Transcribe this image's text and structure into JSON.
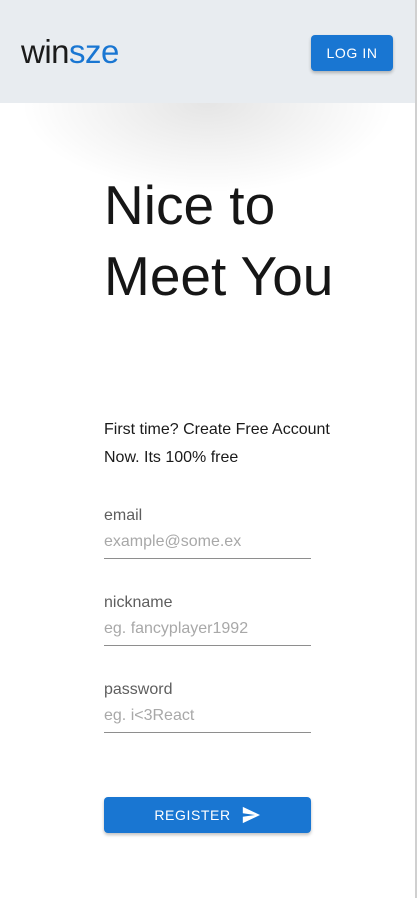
{
  "header": {
    "logo_part1": "win",
    "logo_part2": "sze",
    "login_label": "LOG IN"
  },
  "hero": {
    "title": "Nice to Meet You",
    "subtitle": "First time? Create Free Account Now. Its 100% free"
  },
  "form": {
    "email": {
      "label": "email",
      "placeholder": "example@some.ex",
      "value": ""
    },
    "nickname": {
      "label": "nickname",
      "placeholder": "eg. fancyplayer1992",
      "value": ""
    },
    "password": {
      "label": "password",
      "placeholder": "eg. i<3React",
      "value": ""
    },
    "register_label": "REGISTER",
    "register_icon": "send-icon"
  },
  "colors": {
    "primary": "#1976d2",
    "appbar": "#e8ecf0",
    "text": "#161616"
  }
}
